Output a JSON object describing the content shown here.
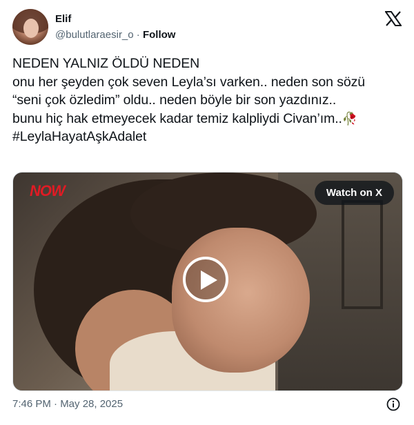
{
  "author": {
    "name": "Elif",
    "handle": "@bulutlaraesir_o",
    "separator": "·",
    "follow_label": "Follow",
    "avatar_icon": "profile-photo"
  },
  "brand_icon": "x-logo-icon",
  "tweet": {
    "lines": [
      "NEDEN YALNIZ ÖLDÜ NEDEN",
      "onu her şeyden çok seven Leyla’sı varken.. neden son sözü",
      "“seni çok özledim” oldu.. neden böyle bir son yazdınız..",
      "bunu hiç hak etmeyecek kadar temiz kalpliydi Civan’ım..",
      "#LeylaHayatAşkAdalet"
    ],
    "emoji": "🥀"
  },
  "media": {
    "channel_logo": "NOW",
    "watch_label": "Watch on X",
    "play_icon": "play-icon"
  },
  "footer": {
    "timestamp": "7:46 PM · May 28, 2025",
    "info_icon": "info-icon"
  },
  "colors": {
    "text": "#0f1419",
    "secondary": "#536471",
    "now_red": "#e01b24"
  }
}
